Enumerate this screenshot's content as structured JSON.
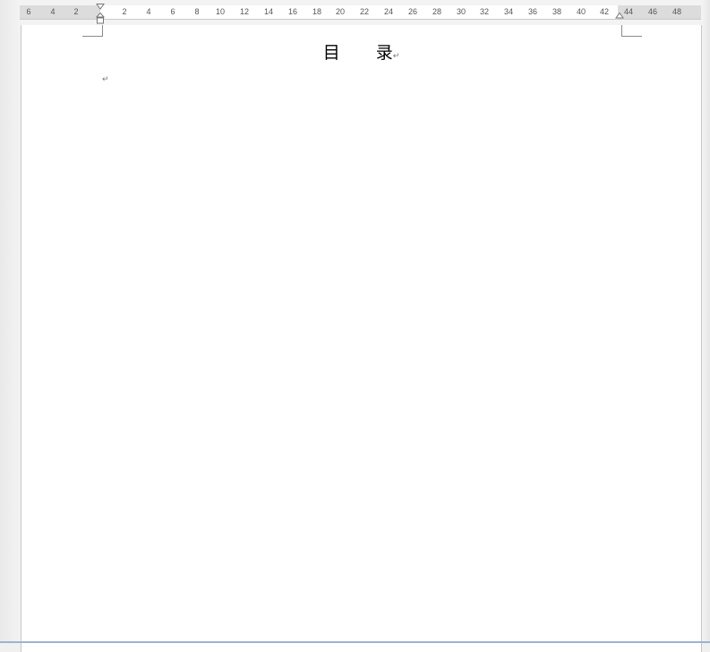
{
  "ruler": {
    "ticks": [
      "6",
      "4",
      "2",
      "2",
      "4",
      "6",
      "8",
      "10",
      "12",
      "14",
      "16",
      "18",
      "20",
      "22",
      "24",
      "26",
      "28",
      "30",
      "32",
      "34",
      "36",
      "38",
      "40",
      "42",
      "44",
      "46",
      "48"
    ]
  },
  "document": {
    "title_char_1": "目",
    "title_char_2": "录",
    "paragraph_mark": "↵"
  }
}
